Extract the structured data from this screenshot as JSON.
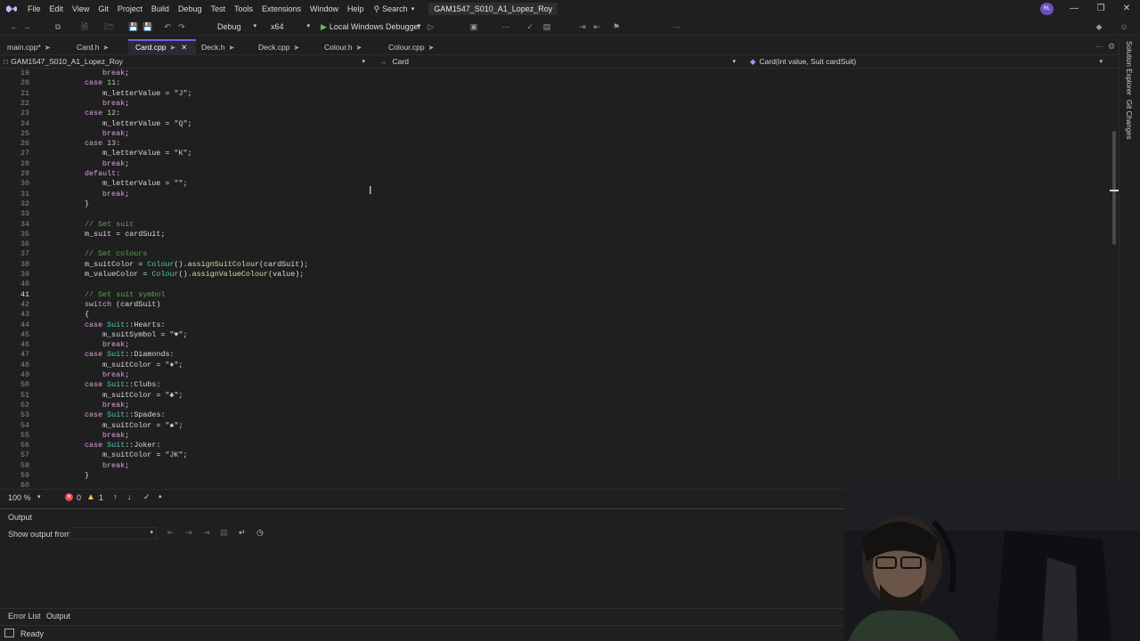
{
  "menubar": {
    "items": [
      "File",
      "Edit",
      "View",
      "Git",
      "Project",
      "Build",
      "Debug",
      "Test",
      "Tools",
      "Extensions",
      "Window",
      "Help"
    ],
    "search_label": "Search",
    "project_title": "GAM1547_S010_A1_Lopez_Roy",
    "avatar_initials": "RL"
  },
  "toolbar": {
    "config": "Debug",
    "platform": "x64",
    "run_label": "Local Windows Debugger"
  },
  "tabs": [
    {
      "label": "main.cpp*"
    },
    {
      "label": "Card.h"
    },
    {
      "label": "Card.cpp",
      "active": true
    },
    {
      "label": "Deck.h"
    },
    {
      "label": "Deck.cpp"
    },
    {
      "label": "Colour.h"
    },
    {
      "label": "Colour.cpp"
    }
  ],
  "navbar": {
    "project": "GAM1547_S010_A1_Lopez_Roy",
    "scope": "Card",
    "member": "Card(int value, Suit cardSuit)"
  },
  "code": {
    "line_numbers": [
      "19",
      "20",
      "21",
      "22",
      "23",
      "24",
      "25",
      "26",
      "27",
      "28",
      "29",
      "30",
      "31",
      "32",
      "33",
      "34",
      "35",
      "36",
      "37",
      "38",
      "39",
      "40",
      "41",
      "42",
      "43",
      "44",
      "45",
      "46",
      "47",
      "48",
      "49",
      "50",
      "51",
      "52",
      "53",
      "54",
      "55",
      "56",
      "57",
      "58",
      "59",
      "60"
    ]
  },
  "editor_status": {
    "zoom": "100 %",
    "errors": "0",
    "warnings": "1"
  },
  "output": {
    "title": "Output",
    "show_from_label": "Show output from:"
  },
  "bottom_tabs": [
    "Error List",
    "Output"
  ],
  "statusbar": {
    "text": "Ready"
  },
  "sidebar": {
    "solution_explorer": "Solution Explorer",
    "git_changes": "Git Changes"
  },
  "colors": {
    "accent": "#7160e8",
    "background": "#1f1f1f",
    "keyword": "#d8a0df",
    "comment": "#57a64a",
    "string": "#e8c9bb",
    "function": "#dcdcaa",
    "type": "#4ec9b0"
  }
}
